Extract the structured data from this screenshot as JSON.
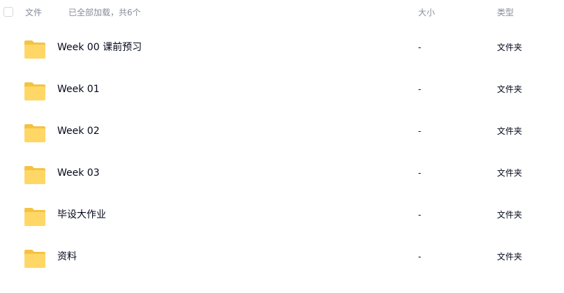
{
  "header": {
    "name_label": "文件",
    "loaded_status": "已全部加载，共6个",
    "size_label": "大小",
    "type_label": "类型"
  },
  "colors": {
    "folder_back": "#f5c342",
    "folder_front": "#ffd766",
    "text_primary": "#03081a",
    "text_secondary": "#878c9c"
  },
  "files": [
    {
      "name": "Week 00 课前预习",
      "size": "-",
      "type": "文件夹",
      "icon": "folder-icon"
    },
    {
      "name": "Week 01",
      "size": "-",
      "type": "文件夹",
      "icon": "folder-icon"
    },
    {
      "name": "Week 02",
      "size": "-",
      "type": "文件夹",
      "icon": "folder-icon"
    },
    {
      "name": "Week 03",
      "size": "-",
      "type": "文件夹",
      "icon": "folder-icon"
    },
    {
      "name": "毕设大作业",
      "size": "-",
      "type": "文件夹",
      "icon": "folder-icon"
    },
    {
      "name": "资料",
      "size": "-",
      "type": "文件夹",
      "icon": "folder-icon"
    }
  ]
}
